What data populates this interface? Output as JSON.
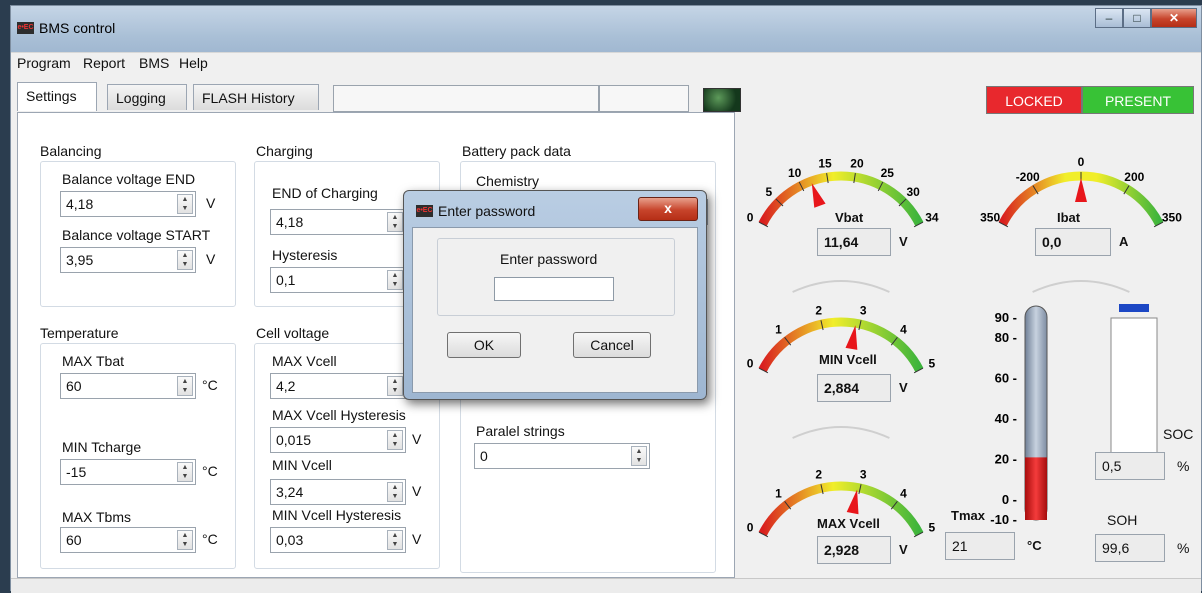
{
  "window": {
    "title": "BMS control",
    "logo_text": "e•EC"
  },
  "menu": [
    "Program",
    "Report",
    "BMS",
    "Help"
  ],
  "tabs": [
    "Settings",
    "Logging",
    "FLASH History"
  ],
  "status": {
    "locked": "LOCKED",
    "present": "PRESENT",
    "locked_color": "#e8282d",
    "present_color": "#38c236"
  },
  "balancing": {
    "title": "Balancing",
    "end_label": "Balance voltage END",
    "end_value": "4,18",
    "end_unit": "V",
    "start_label": "Balance voltage START",
    "start_value": "3,95",
    "start_unit": "V"
  },
  "charging": {
    "title": "Charging",
    "end_label": "END of Charging",
    "end_value": "4,18",
    "hyst_label": "Hysteresis",
    "hyst_value": "0,1"
  },
  "battery_pack": {
    "title": "Battery pack data",
    "chemistry_label": "Chemistry",
    "paralel_label": "Paralel strings",
    "paralel_value": "0"
  },
  "temperature": {
    "title": "Temperature",
    "max_tbat_label": "MAX Tbat",
    "max_tbat_value": "60",
    "max_tbat_unit": "°C",
    "min_tcharge_label": "MIN Tcharge",
    "min_tcharge_value": "-15",
    "min_tcharge_unit": "°C",
    "max_tbms_label": "MAX Tbms",
    "max_tbms_value": "60",
    "max_tbms_unit": "°C"
  },
  "cell_voltage": {
    "title": "Cell voltage",
    "max_vcell_label": "MAX Vcell",
    "max_vcell_value": "4,2",
    "max_hyst_label": "MAX Vcell Hysteresis",
    "max_hyst_value": "0,015",
    "max_hyst_unit": "V",
    "min_vcell_label": "MIN Vcell",
    "min_vcell_value": "3,24",
    "min_vcell_unit": "V",
    "min_hyst_label": "MIN Vcell Hysteresis",
    "min_hyst_value": "0,03",
    "min_hyst_unit": "V"
  },
  "dialog": {
    "title": "Enter password",
    "close": "x",
    "prompt": "Enter password",
    "password_value": "",
    "ok": "OK",
    "cancel": "Cancel"
  },
  "gauges": {
    "vbat": {
      "label": "Vbat",
      "value": "11,64",
      "unit": "V",
      "ticks": [
        "0",
        "5",
        "10",
        "15",
        "20",
        "25",
        "30",
        "34"
      ],
      "min": 0,
      "max": 34,
      "needle": 11.64
    },
    "ibat": {
      "label": "Ibat",
      "value": "0,0",
      "unit": "A",
      "ticks": [
        "350",
        "-200",
        "0",
        "200",
        "350"
      ],
      "min": -350,
      "max": 350,
      "needle": 0
    },
    "min_vcell": {
      "label": "MIN Vcell",
      "value": "2,884",
      "unit": "V",
      "ticks": [
        "0",
        "1",
        "2",
        "3",
        "4",
        "5"
      ],
      "min": 0,
      "max": 5,
      "needle": 2.884
    },
    "max_vcell": {
      "label": "MAX Vcell",
      "value": "2,928",
      "unit": "V",
      "ticks": [
        "0",
        "1",
        "2",
        "3",
        "4",
        "5"
      ],
      "min": 0,
      "max": 5,
      "needle": 2.928
    }
  },
  "thermometer": {
    "label": "Tmax",
    "value": "21",
    "unit": "°C",
    "scale": [
      "90",
      "80",
      "60",
      "40",
      "20",
      "0",
      "-10"
    ],
    "min": -10,
    "max": 90,
    "level": 21
  },
  "soc": {
    "label": "SOC",
    "value": "0,5",
    "unit": "%",
    "level": 0.5
  },
  "soh": {
    "label": "SOH",
    "value": "99,6",
    "unit": "%"
  }
}
